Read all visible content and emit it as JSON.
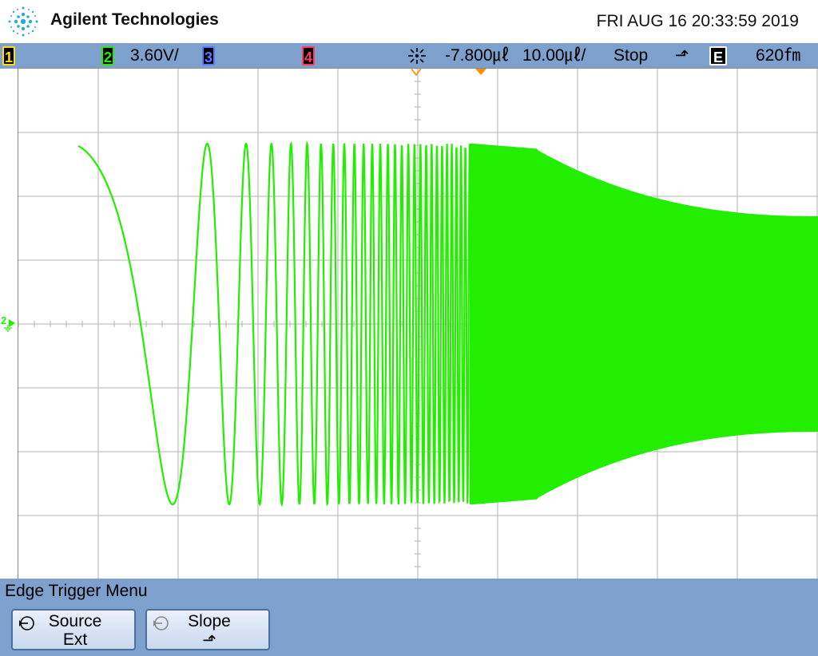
{
  "header": {
    "brand": "Agilent Technologies",
    "datetime": "FRI AUG 16 20:33:59 2019"
  },
  "status_bar": {
    "ch1_label": "1",
    "ch2_label": "2",
    "ch2_scale": "3.60V/",
    "ch3_label": "3",
    "ch4_label": "4",
    "trigger_delay": "-7.800㎕",
    "timebase": "10.00㎕/",
    "run_state": "Stop",
    "trigger_slope_glyph": "⬏",
    "trigger_source_label": "E",
    "trigger_level": "620㎙"
  },
  "display": {
    "ch2_marker_label": "2",
    "trace_color": "#22ee00",
    "grid_color": "#b0b0b0"
  },
  "menu": {
    "title": "Edge Trigger Menu",
    "softkeys": [
      {
        "label": "Source",
        "value": "Ext"
      },
      {
        "label": "Slope",
        "value": "⬏"
      }
    ]
  }
}
